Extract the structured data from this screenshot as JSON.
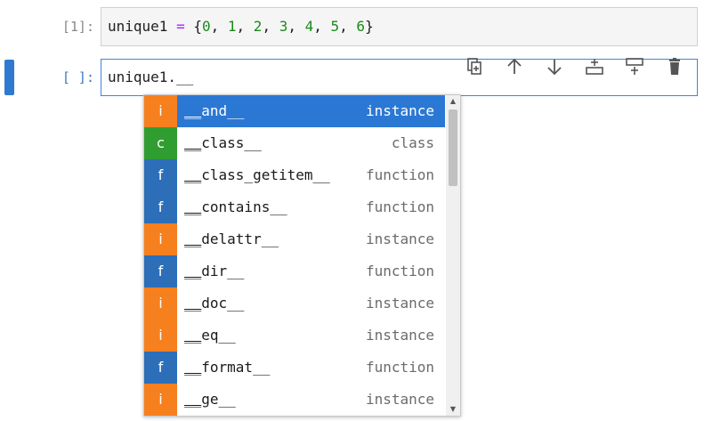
{
  "cells": [
    {
      "prompt": "[1]:",
      "tokens": [
        {
          "t": "unique1",
          "c": "name"
        },
        {
          "t": " ",
          "c": "punc"
        },
        {
          "t": "=",
          "c": "op"
        },
        {
          "t": " {",
          "c": "punc"
        },
        {
          "t": "0",
          "c": "num"
        },
        {
          "t": ", ",
          "c": "punc"
        },
        {
          "t": "1",
          "c": "num"
        },
        {
          "t": ", ",
          "c": "punc"
        },
        {
          "t": "2",
          "c": "num"
        },
        {
          "t": ", ",
          "c": "punc"
        },
        {
          "t": "3",
          "c": "num"
        },
        {
          "t": ", ",
          "c": "punc"
        },
        {
          "t": "4",
          "c": "num"
        },
        {
          "t": ", ",
          "c": "punc"
        },
        {
          "t": "5",
          "c": "num"
        },
        {
          "t": ", ",
          "c": "punc"
        },
        {
          "t": "6",
          "c": "num"
        },
        {
          "t": "}",
          "c": "punc"
        }
      ]
    },
    {
      "prompt": "[ ]:",
      "code": "unique1.__"
    }
  ],
  "toolbar": [
    {
      "name": "duplicate-cell-icon"
    },
    {
      "name": "move-up-icon"
    },
    {
      "name": "move-down-icon"
    },
    {
      "name": "insert-cell-above-icon"
    },
    {
      "name": "insert-cell-below-icon"
    },
    {
      "name": "delete-cell-icon"
    }
  ],
  "completer": {
    "items": [
      {
        "type": "i",
        "label": "__and__",
        "kind": "instance",
        "selected": true
      },
      {
        "type": "c",
        "label": "__class__",
        "kind": "class"
      },
      {
        "type": "f",
        "label": "__class_getitem__",
        "kind": "function"
      },
      {
        "type": "f",
        "label": "__contains__",
        "kind": "function"
      },
      {
        "type": "i",
        "label": "__delattr__",
        "kind": "instance"
      },
      {
        "type": "f",
        "label": "__dir__",
        "kind": "function"
      },
      {
        "type": "i",
        "label": "__doc__",
        "kind": "instance"
      },
      {
        "type": "i",
        "label": "__eq__",
        "kind": "instance"
      },
      {
        "type": "f",
        "label": "__format__",
        "kind": "function"
      },
      {
        "type": "i",
        "label": "__ge__",
        "kind": "instance"
      }
    ],
    "match_prefix": "__",
    "scroll_up_glyph": "▲",
    "scroll_down_glyph": "▼"
  },
  "colors": {
    "accent": "#2b78d4",
    "type_instance": "#f67f1e",
    "type_class": "#2f9d2f",
    "type_function": "#2c6fb8",
    "number": "#1a8a1a",
    "operator": "#aa22ff"
  }
}
